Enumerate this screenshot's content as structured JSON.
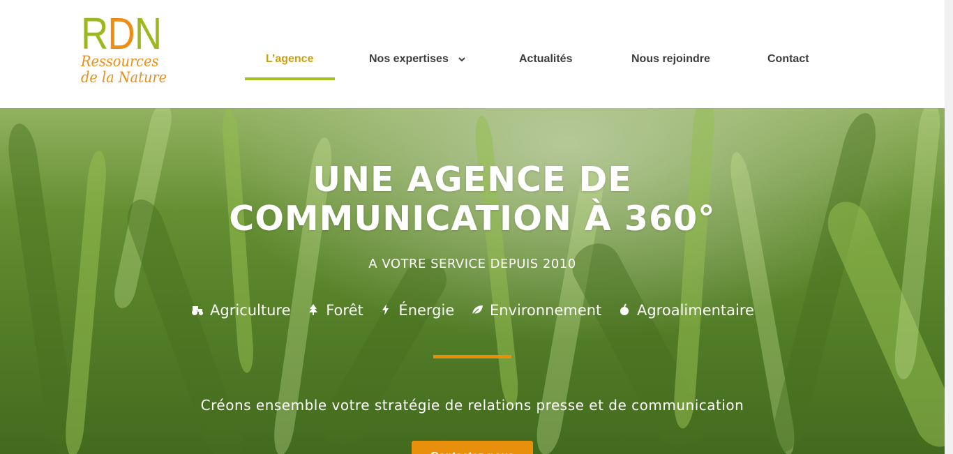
{
  "logo": {
    "r": "R",
    "d": "D",
    "n": "N",
    "line1": "Ressources",
    "line2": "de la Nature"
  },
  "nav": {
    "items": [
      {
        "label": "L’agence",
        "active": true
      },
      {
        "label": "Nos expertises",
        "has_dropdown": true
      },
      {
        "label": "Actualités"
      },
      {
        "label": "Nous rejoindre"
      },
      {
        "label": "Contact"
      }
    ]
  },
  "hero": {
    "title_line1": "UNE AGENCE DE",
    "title_line2": "COMMUNICATION À 360°",
    "subtitle": "A VOTRE SERVICE DEPUIS 2010",
    "sectors": [
      {
        "icon": "tractor-icon",
        "label": "Agriculture"
      },
      {
        "icon": "tree-icon",
        "label": "Forêt"
      },
      {
        "icon": "bolt-icon",
        "label": "Énergie"
      },
      {
        "icon": "leaf-icon",
        "label": "Environnement"
      },
      {
        "icon": "apple-icon",
        "label": "Agroalimentaire"
      }
    ],
    "tagline": "Créons ensemble votre stratégie de relations presse et de communication",
    "cta_label": "Contactez-nous"
  },
  "colors": {
    "brand_green": "#9bb81c",
    "brand_orange": "#e88f0c",
    "active_nav_text": "#c8a214",
    "nav_text": "#3d3d3d"
  }
}
